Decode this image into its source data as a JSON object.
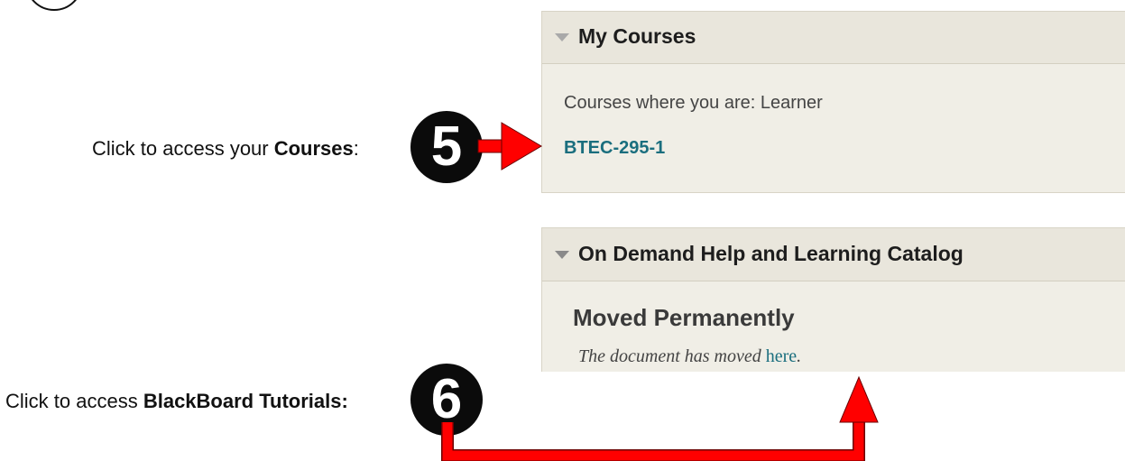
{
  "my_courses": {
    "title": "My Courses",
    "role_text": "Courses where you are: Learner",
    "course_link": "BTEC-295-1"
  },
  "help_catalog": {
    "title": "On Demand Help and Learning Catalog",
    "heading": "Moved Permanently",
    "text_prefix": "The document has moved ",
    "link": "here",
    "text_suffix": "."
  },
  "instructions": {
    "step5": {
      "number": "5",
      "prefix": "Click to access your ",
      "bold": "Courses",
      "suffix": ":"
    },
    "step6": {
      "number": "6",
      "prefix": "Click to access ",
      "bold": "BlackBoard Tutorials:"
    }
  },
  "colors": {
    "arrow": "#ff0000",
    "link": "#1a6e7e",
    "badge": "#0b0b0b"
  }
}
